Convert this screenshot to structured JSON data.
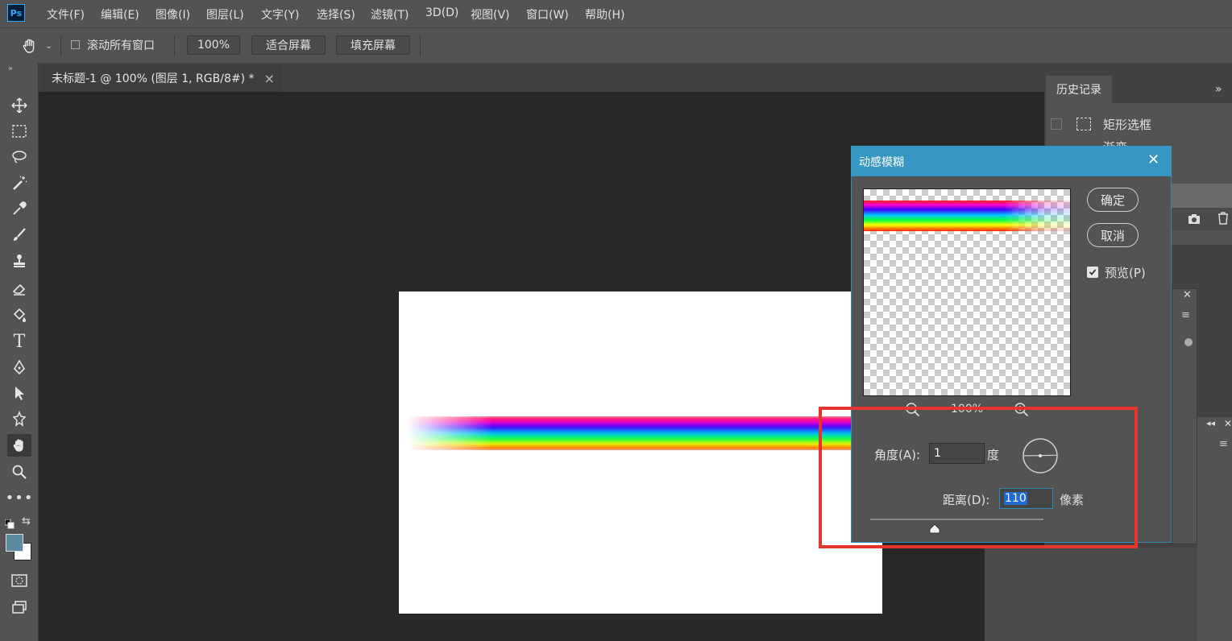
{
  "app": {
    "logo": "Ps"
  },
  "menu": [
    "文件(F)",
    "编辑(E)",
    "图像(I)",
    "图层(L)",
    "文字(Y)",
    "选择(S)",
    "滤镜(T)",
    "3D(D)",
    "视图(V)",
    "窗口(W)",
    "帮助(H)"
  ],
  "options": {
    "scroll_all_label": "滚动所有窗口",
    "scroll_all_checked": false,
    "zoom_value": "100%",
    "fit_screen_label": "适合屏幕",
    "fill_screen_label": "填充屏幕"
  },
  "document_tab": {
    "title": "未标题-1 @ 100% (图层 1, RGB/8#) *",
    "close": "×"
  },
  "history_panel": {
    "tab_label": "历史记录",
    "collapse_glyph": "»",
    "items": [
      {
        "label": "矩形选框",
        "icon": "marquee-icon"
      },
      {
        "label": "渐变",
        "icon": "gradient-icon"
      }
    ]
  },
  "dialog": {
    "title": "动感模糊",
    "ok_label": "确定",
    "cancel_label": "取消",
    "preview_label": "预览(P)",
    "preview_checked": true,
    "zoom_level": "100%",
    "angle_label": "角度(A):",
    "angle_value": "1",
    "angle_unit": "度",
    "distance_label": "距离(D):",
    "distance_value": "110",
    "distance_unit": "像素",
    "distance_slider_fraction": 0.37
  },
  "colors": {
    "foreground": "#5b8aa0",
    "background": "#ffffff",
    "dialog_title_bar": "#3896c4",
    "highlight": "#e8342f"
  }
}
